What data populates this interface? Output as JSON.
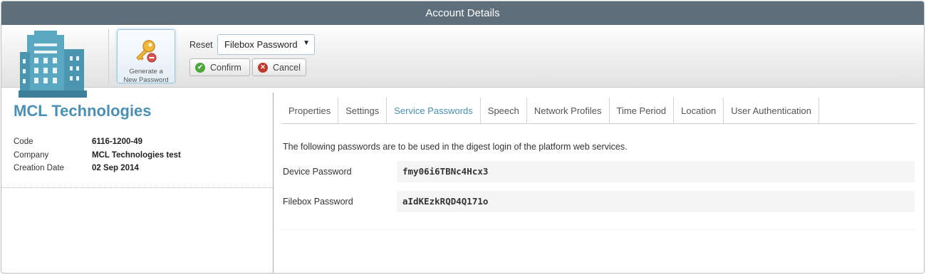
{
  "window": {
    "title": "Account Details"
  },
  "toolbar": {
    "generate_label_line1": "Generate a",
    "generate_label_line2": "New Password",
    "reset_label": "Reset",
    "reset_selected": "Filebox Password",
    "confirm_label": "Confirm",
    "cancel_label": "Cancel"
  },
  "account": {
    "name": "MCL Technologies",
    "fields": [
      {
        "label": "Code",
        "value": "6116-1200-49"
      },
      {
        "label": "Company",
        "value": "MCL Technologies test"
      },
      {
        "label": "Creation Date",
        "value": "02 Sep 2014"
      }
    ]
  },
  "tabs": [
    {
      "label": "Properties"
    },
    {
      "label": "Settings"
    },
    {
      "label": "Service Passwords"
    },
    {
      "label": "Speech"
    },
    {
      "label": "Network Profiles"
    },
    {
      "label": "Time Period"
    },
    {
      "label": "Location"
    },
    {
      "label": "User Authentication"
    }
  ],
  "active_tab": "Service Passwords",
  "service_passwords": {
    "description": "The following passwords are to be used in the digest login of the platform web services.",
    "rows": [
      {
        "label": "Device Password",
        "value": "fmy06i6TBNc4Hcx3"
      },
      {
        "label": "Filebox Password",
        "value": "aIdKEzkRQD4Q171o"
      }
    ]
  },
  "colors": {
    "titlebar": "#5e6f7b",
    "accent": "#4a90b4",
    "confirm_icon": "#4fa63b",
    "cancel_icon": "#c0392b"
  },
  "icons": {
    "building": "building-icon",
    "key": "key-icon",
    "confirm": "check-circle-icon",
    "cancel": "close-circle-icon",
    "dropdown": "caret-down-icon"
  }
}
